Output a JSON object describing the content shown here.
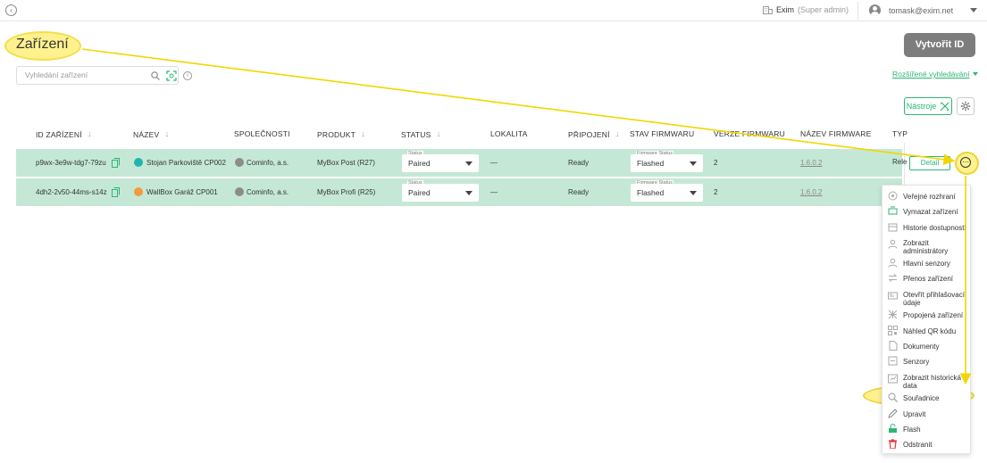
{
  "topbar": {
    "company": "Exim",
    "role": "(Super admin)",
    "user_email": "tomask@exim.net"
  },
  "page": {
    "title": "Zařízení",
    "create_button": "Vytvořit ID",
    "advanced_search": "Rozšířené vyhledávání",
    "search_placeholder": "Vyhledání zařízení",
    "tools_button": "Nástroje"
  },
  "table": {
    "columns": [
      "ID ZAŘÍZENÍ",
      "NÁZEV",
      "SPOLEČNOSTI",
      "PRODUKT",
      "STATUS",
      "LOKALITA",
      "PŘIPOJENÍ",
      "STAV FIRMWARU",
      "VERZE FIRMWARU",
      "NÁZEV FIRMWARE",
      "TYP"
    ],
    "rows": [
      {
        "id": "p9wx-3e9w-tdg7-79zu",
        "name": "Stojan Parkoviště CP002",
        "name_dot_color": "#1fb5ad",
        "company": "Cominfo, a.s.",
        "product": "MyBox Post (R27)",
        "status_label": "Status",
        "status": "Paired",
        "location": "—",
        "connection": "Ready",
        "fw_status_label": "Firmware Status",
        "fw_status": "Flashed",
        "fw_version": "2",
        "fw_name": "1.6.0.2",
        "type_cut": "Rele",
        "detail": "Detail"
      },
      {
        "id": "4dh2-2v50-44ms-s14z",
        "name": "WallBox Garáž CP001",
        "name_dot_color": "#f59a3b",
        "company": "Cominfo, a.s.",
        "product": "MyBox Profi (R25)",
        "status_label": "Status",
        "status": "Paired",
        "location": "—",
        "connection": "Ready",
        "fw_status_label": "Firmware Status",
        "fw_status": "Flashed",
        "fw_version": "2",
        "fw_name": "1.6.0.2"
      }
    ]
  },
  "menu": {
    "items": [
      {
        "label": "Veřejné rozhraní",
        "icon": "public-api-icon"
      },
      {
        "label": "Vymazat zařízení",
        "icon": "erase-device-icon"
      },
      {
        "label": "Historie dostupnosti",
        "icon": "availability-history-icon"
      },
      {
        "label": "Zobrazit administrátory",
        "icon": "administrators-icon"
      },
      {
        "label": "Hlavní senzory",
        "icon": "main-sensors-icon"
      },
      {
        "label": "Přenos zařízení",
        "icon": "transfer-icon"
      },
      {
        "label": "Otevřít přihlašovací údaje",
        "icon": "credentials-icon"
      },
      {
        "label": "Propojená zařízení",
        "icon": "linked-devices-icon"
      },
      {
        "label": "Náhled QR kódu",
        "icon": "qr-code-icon"
      },
      {
        "label": "Dokumenty",
        "icon": "documents-icon"
      },
      {
        "label": "Senzory",
        "icon": "sensors-icon"
      },
      {
        "label": "Zobrazit historická data",
        "icon": "historical-data-icon"
      },
      {
        "label": "Souřadnice",
        "icon": "coordinates-icon"
      },
      {
        "label": "Upravit",
        "icon": "edit-icon"
      },
      {
        "label": "Flash",
        "icon": "flash-icon"
      },
      {
        "label": "Odstranit",
        "icon": "delete-icon"
      }
    ]
  },
  "colors": {
    "accent": "#2bb673",
    "row_bg": "#c5e8d6",
    "highlight": "#fff18e",
    "delete": "#e53935"
  }
}
